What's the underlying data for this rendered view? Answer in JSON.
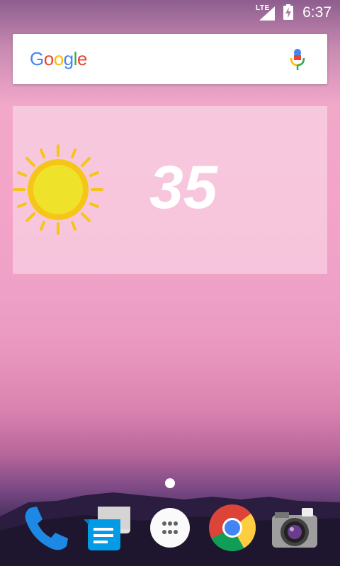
{
  "status_bar": {
    "network": "LTE",
    "time": "6:37"
  },
  "search": {
    "logo": [
      "G",
      "o",
      "o",
      "g",
      "l",
      "e"
    ]
  },
  "weather": {
    "temperature": "35",
    "icon": "sun-icon"
  },
  "home": {
    "page_indicator": {
      "count": 1,
      "active": 0
    }
  },
  "dock": {
    "apps": [
      {
        "name": "phone",
        "icon": "phone-icon"
      },
      {
        "name": "messages",
        "icon": "messages-icon"
      },
      {
        "name": "app-drawer",
        "icon": "app-drawer-icon"
      },
      {
        "name": "chrome",
        "icon": "chrome-icon"
      },
      {
        "name": "camera",
        "icon": "camera-icon"
      }
    ]
  }
}
